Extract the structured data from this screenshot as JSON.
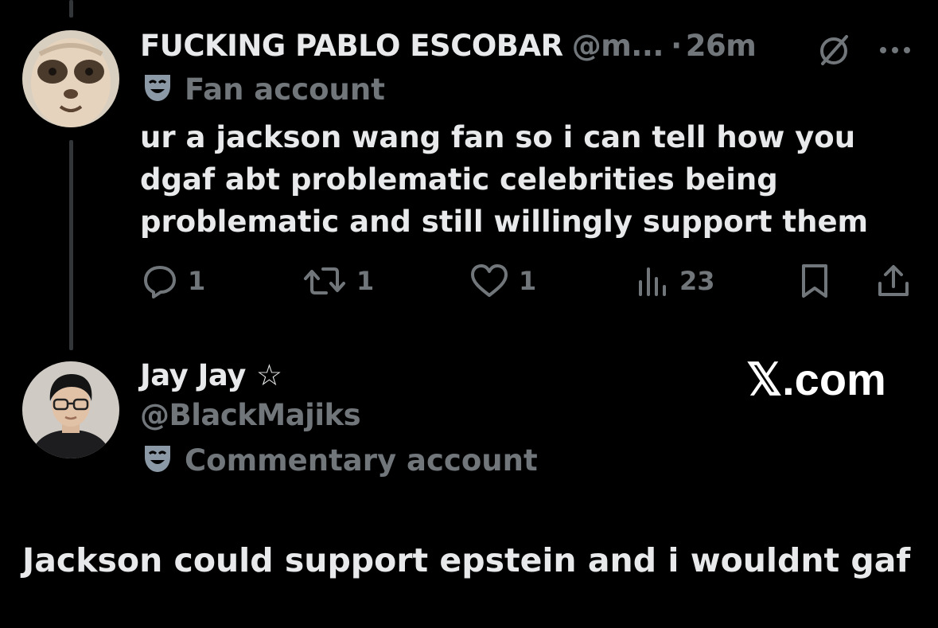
{
  "colors": {
    "background": "#000000",
    "text_primary": "#e7e9ea",
    "text_muted": "#71767b",
    "thread_line": "#333639"
  },
  "original_tweet": {
    "display_name": "FUCKING PABLO ESCOBAR",
    "handle": "@m...",
    "separator": "·",
    "time": "26m",
    "account_label": "Fan account",
    "account_label_icon": "theater-mask-icon",
    "text_lines": [
      "ur a jackson wang fan so i can tell how you",
      "dgaf abt problematic celebrities being",
      "problematic and still willingly support them"
    ],
    "actions": {
      "replies": "1",
      "reposts": "1",
      "likes": "1",
      "views": "23"
    }
  },
  "reply_tweet": {
    "display_name": "Jay Jay",
    "star": "☆",
    "handle": "@BlackMajiks",
    "account_label": "Commentary account",
    "account_label_icon": "theater-mask-icon",
    "text": "Jackson could support epstein and i wouldnt gaf"
  },
  "watermark": "𝕏.com"
}
